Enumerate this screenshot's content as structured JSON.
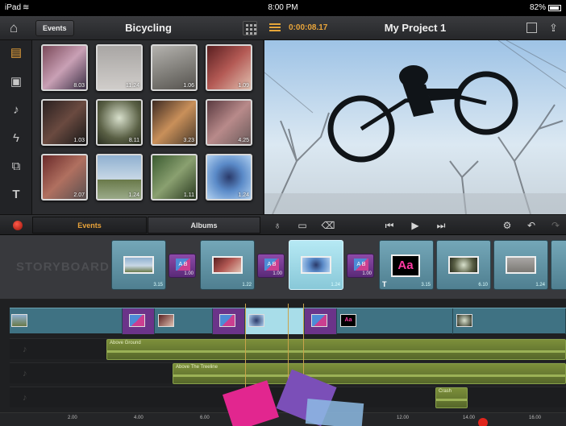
{
  "status_bar": {
    "device": "iPad",
    "time": "8:00 PM",
    "battery": "82%"
  },
  "top_bar": {
    "events_label": "Events",
    "library_title": "Bicycling",
    "timecode": "0:00:08.17",
    "project_title": "My Project 1"
  },
  "library": {
    "clips": [
      {
        "duration": "8.03"
      },
      {
        "duration": "11.24"
      },
      {
        "duration": "1.06"
      },
      {
        "duration": "1.09"
      },
      {
        "duration": "1.03"
      },
      {
        "duration": "8.11"
      },
      {
        "duration": "3.23"
      },
      {
        "duration": "4.25"
      },
      {
        "duration": "2.07"
      },
      {
        "duration": "1.24"
      },
      {
        "duration": "1.11"
      },
      {
        "duration": "1.24"
      }
    ]
  },
  "tabs": {
    "events": "Events",
    "albums": "Albums"
  },
  "storyboard": {
    "label": "STORYBOARD",
    "items": [
      {
        "kind": "clip",
        "duration": "3.15"
      },
      {
        "kind": "transition",
        "duration": "1.00"
      },
      {
        "kind": "clip",
        "duration": "1.22"
      },
      {
        "kind": "transition",
        "duration": "1.00"
      },
      {
        "kind": "clip",
        "duration": "1.24",
        "selected": true
      },
      {
        "kind": "transition",
        "duration": "1.00"
      },
      {
        "kind": "title",
        "duration": "3.15",
        "title_text": "Aa"
      },
      {
        "kind": "clip",
        "duration": "6.10"
      },
      {
        "kind": "clip",
        "duration": "1.24"
      }
    ],
    "transition_label": "A B"
  },
  "timeline": {
    "audio_tracks": [
      {
        "name": "Above Ground"
      },
      {
        "name": "Above The Treeline"
      },
      {
        "name": "Crash"
      }
    ],
    "title_text": "Aa",
    "ruler": [
      "2.00",
      "4.00",
      "6.00",
      "12.00",
      "14.00",
      "16.00"
    ]
  },
  "colors": {
    "accent": "#e9a33a",
    "clip": "#4f7f90",
    "transition": "#6b3489",
    "audio": "#6b7f32",
    "record": "#e0251c"
  }
}
